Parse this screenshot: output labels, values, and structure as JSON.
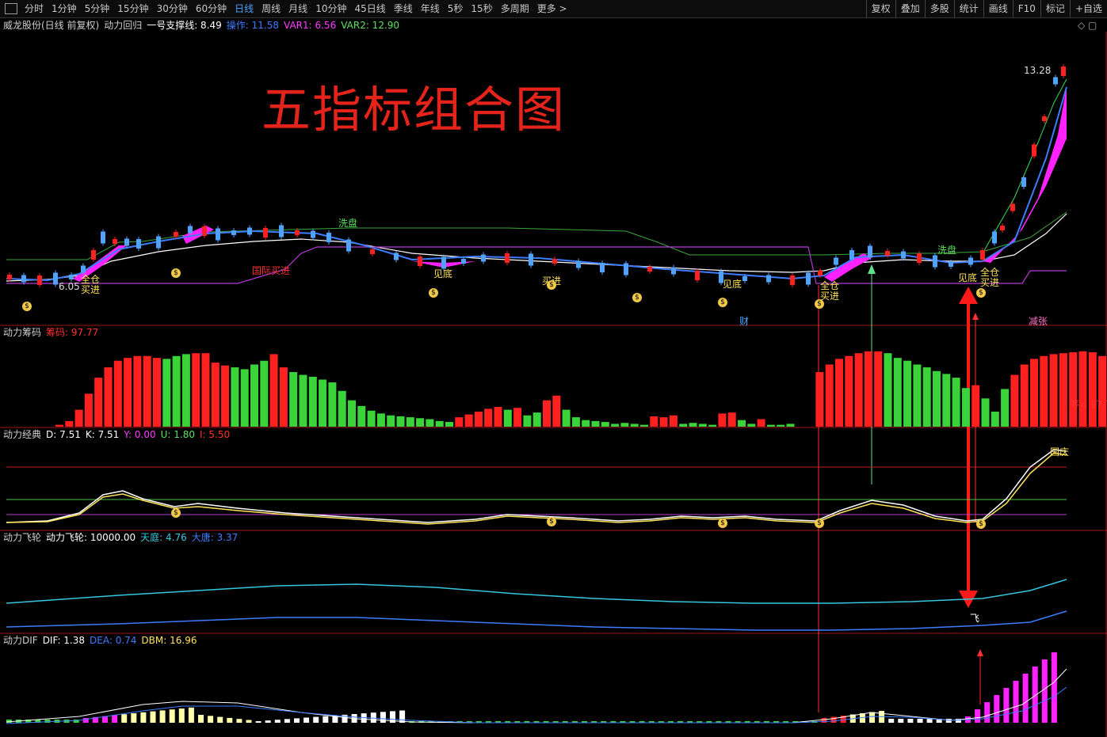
{
  "toolbar": {
    "periods": [
      "分时",
      "1分钟",
      "5分钟",
      "15分钟",
      "30分钟",
      "60分钟",
      "日线",
      "周线",
      "月线",
      "10分钟",
      "45日线",
      "季线",
      "年线",
      "5秒",
      "15秒",
      "多周期",
      "更多 >"
    ],
    "active_period": "日线",
    "right_buttons": [
      "复权",
      "叠加",
      "多股",
      "统计",
      "画线",
      "F10",
      "标记",
      "+自选"
    ]
  },
  "info": {
    "stock": "威龙股份(日线 前复权)",
    "indicator": "动力回归",
    "support_label": "一号支撑线: 8.49",
    "op_label": "操作: 11.58",
    "var1": "VAR1: 6.56",
    "var2": "VAR2: 12.90"
  },
  "overlay_title": "五指标组合图",
  "main_chart": {
    "high_label": "13.28",
    "low_label": "6.05",
    "annotations": [
      "全仓",
      "买进",
      "国际买进",
      "洗盘",
      "见底",
      "买进",
      "见底",
      "全仓",
      "买进",
      "洗盘",
      "见底",
      "全仓",
      "买进",
      "财"
    ]
  },
  "panels": {
    "chip": {
      "name": "动力筹码",
      "value_label": "筹码: 97.77",
      "edge_label": "筹= 97.7",
      "tag": "减张"
    },
    "classic": {
      "name": "动力经典",
      "d": "D: 7.51",
      "k": "K: 7.51",
      "y": "Y: 0.00",
      "u": "U: 1.80",
      "l": "I: 5.50",
      "tag": "国庆"
    },
    "flywheel": {
      "name": "动力飞轮",
      "value": "动力飞轮: 10000.00",
      "tianting": "天庭: 4.76",
      "datang": "大唐: 3.37",
      "tag": "飞"
    },
    "dif": {
      "name": "动力DIF",
      "dif": "DIF: 1.38",
      "dea": "DEA: 0.74",
      "dbm": "DBM: 16.96"
    }
  },
  "chart_data": {
    "type": "bar",
    "title": "动力筹码",
    "values": [
      2,
      6,
      18,
      35,
      52,
      63,
      70,
      73,
      75,
      75,
      73,
      72,
      75,
      77,
      78,
      78,
      68,
      65,
      63,
      61,
      66,
      70,
      77,
      63,
      58,
      55,
      53,
      50,
      47,
      38,
      28,
      22,
      17,
      14,
      12,
      11,
      10,
      9,
      8,
      6,
      5,
      10,
      13,
      16,
      19,
      21,
      18,
      20,
      12,
      15,
      28,
      33,
      18,
      10,
      7,
      6,
      5,
      3,
      4,
      3,
      2,
      11,
      10,
      12,
      3,
      4,
      3,
      2,
      14,
      15,
      7,
      3,
      8,
      2,
      2,
      3,
      0,
      0,
      58,
      66,
      72,
      75,
      78,
      80,
      80,
      78,
      73,
      70,
      66,
      63,
      59,
      56,
      52,
      41,
      44,
      30,
      16,
      40,
      55,
      66,
      72,
      75,
      77,
      78,
      79,
      80,
      79,
      75,
      78
    ],
    "colors": [
      "red",
      "red",
      "red",
      "red",
      "red",
      "red",
      "red",
      "red",
      "red",
      "red",
      "red",
      "green",
      "green",
      "green",
      "red",
      "red",
      "red",
      "red",
      "green",
      "green",
      "green",
      "green",
      "red",
      "red",
      "green",
      "green",
      "green",
      "green",
      "green",
      "green",
      "green",
      "green",
      "green",
      "green",
      "green",
      "green",
      "green",
      "green",
      "green",
      "green",
      "green",
      "red",
      "red",
      "red",
      "red",
      "red",
      "green",
      "red",
      "green",
      "green",
      "red",
      "red",
      "green",
      "green",
      "green",
      "green",
      "green",
      "green",
      "green",
      "green",
      "green",
      "red",
      "red",
      "red",
      "green",
      "green",
      "green",
      "green",
      "red",
      "red",
      "green",
      "green",
      "red",
      "green",
      "green",
      "green",
      "green",
      "green",
      "red",
      "red",
      "red",
      "red",
      "red",
      "red",
      "red",
      "green",
      "green",
      "green",
      "green",
      "green",
      "green",
      "green",
      "green",
      "green",
      "red",
      "green",
      "green",
      "green",
      "red",
      "red",
      "red",
      "red",
      "red",
      "red",
      "red",
      "red",
      "red",
      "red",
      "green",
      "red"
    ],
    "ylim": [
      0,
      100
    ]
  },
  "colors": {
    "up": "#ff2020",
    "down": "#3ad43a",
    "magenta": "#ff22ff",
    "blue": "#3e7cff",
    "yellow": "#ffe35a",
    "cyan": "#36c6e0"
  }
}
